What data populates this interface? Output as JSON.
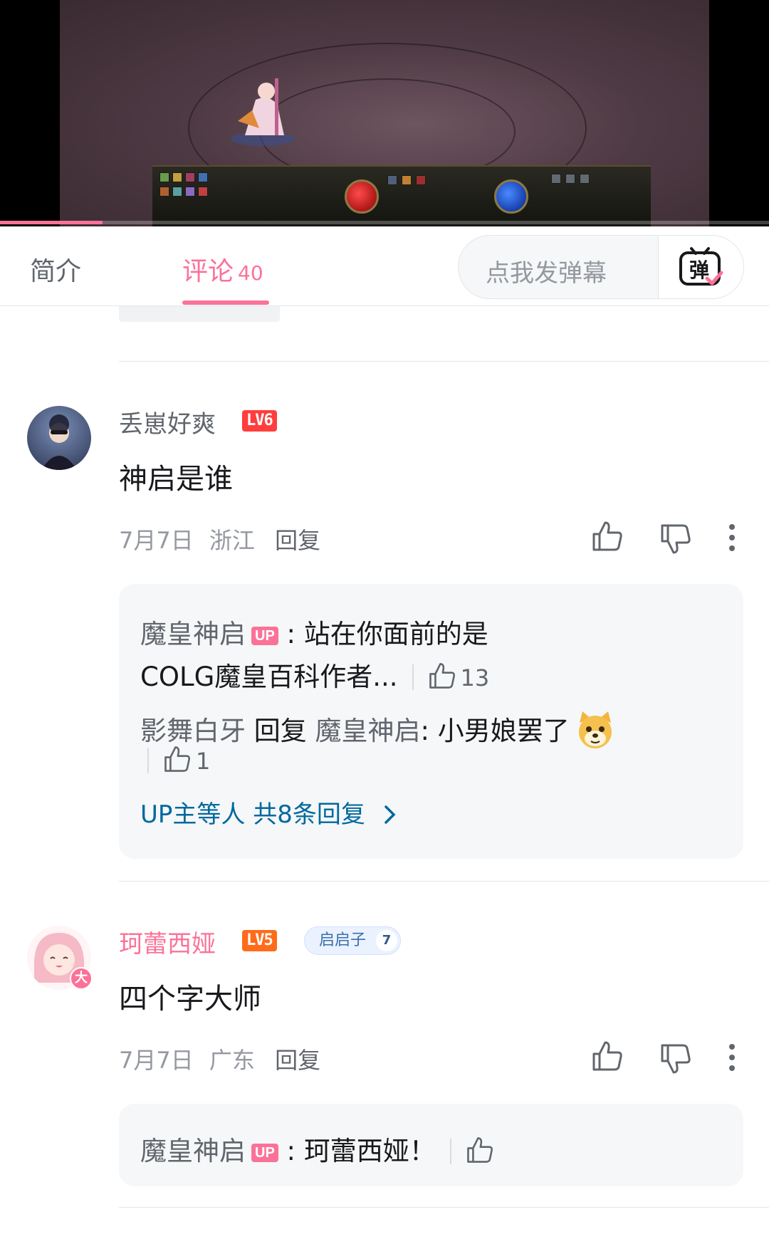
{
  "tabs": {
    "intro_label": "简介",
    "comments_label": "评论",
    "comments_count": "40",
    "danmaku_placeholder": "点我发弹幕",
    "danmaku_button_glyph": "弹"
  },
  "video": {
    "progress_percent": 13.3
  },
  "comments": [
    {
      "username": "丢崽好爽",
      "level": "LV6",
      "text": "神启是谁",
      "date": "7月7日",
      "location": "浙江",
      "reply_label": "回复",
      "replies": [
        {
          "author": "魔皇神启",
          "badge": "UP",
          "text_line1": "站在你面前的是",
          "text_line2": "COLG魔皇百科作者...",
          "likes": "13"
        },
        {
          "author": "影舞白牙",
          "reply_word": "回复",
          "target": "魔皇神启",
          "text": "小男娘罢了",
          "likes": "1"
        }
      ],
      "more_replies": "UP主等人 共8条回复"
    },
    {
      "username": "珂蕾西娅",
      "level": "LV5",
      "fan_badge_name": "启启子",
      "fan_badge_level": "7",
      "avatar_badge": "大",
      "text": "四个字大师",
      "date": "7月7日",
      "location": "广东",
      "reply_label": "回复",
      "replies": [
        {
          "author": "魔皇神启",
          "badge": "UP",
          "text": "珂蕾西娅！"
        }
      ]
    }
  ],
  "colors": {
    "accent_pink": "#fb7299",
    "link_blue": "#00699d",
    "muted": "#9499a0"
  }
}
